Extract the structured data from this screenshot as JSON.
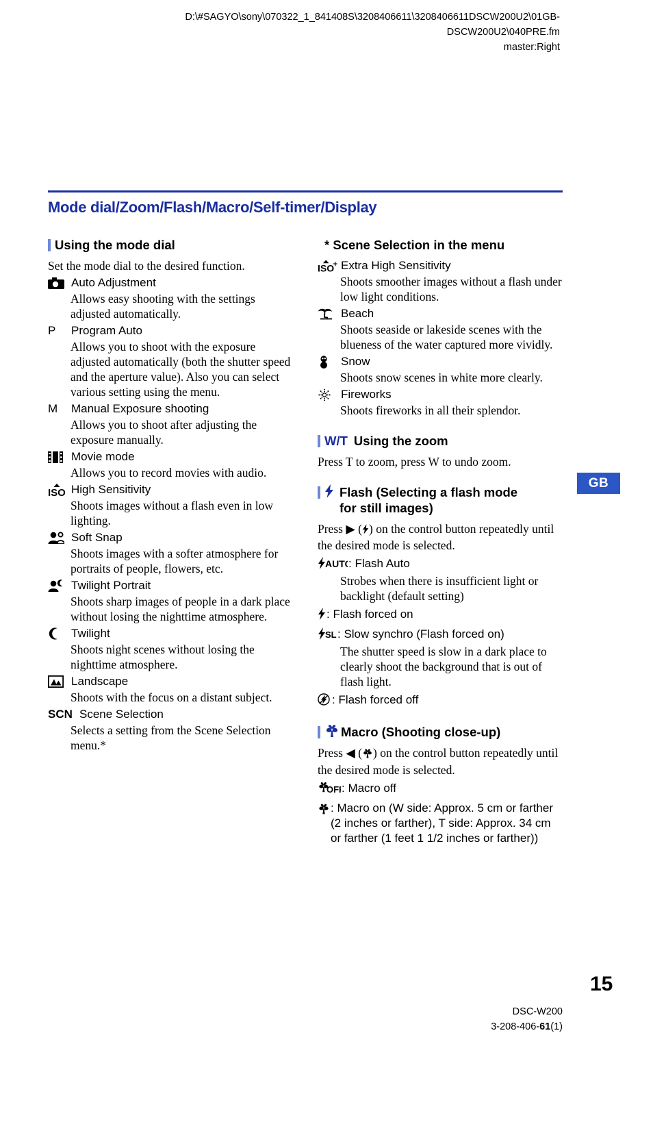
{
  "header": {
    "line1": "D:\\#SAGYO\\sony\\070322_1_841408S\\3208406611\\3208406611DSCW200U2\\01GB-",
    "line2": "DSCW200U2\\040PRE.fm",
    "line3": "master:Right"
  },
  "page_title": "Mode dial/Zoom/Flash/Macro/Self-timer/Display",
  "left_column": {
    "heading": "Using the mode dial",
    "intro": "Set the mode dial to the desired function.",
    "modes": [
      {
        "icon": "camera-icon",
        "label": "Auto Adjustment",
        "desc": "Allows easy shooting with the settings adjusted automatically."
      },
      {
        "icon": "letter-p",
        "label": "Program Auto",
        "desc": "Allows you to shoot with the exposure adjusted automatically (both the shutter speed and the aperture value). Also you can select various setting using the menu."
      },
      {
        "icon": "letter-m",
        "label": "Manual Exposure shooting",
        "desc": "Allows you to shoot after adjusting the exposure manually."
      },
      {
        "icon": "film-strip-icon",
        "label": "Movie mode",
        "desc": "Allows you to record movies with audio."
      },
      {
        "icon": "iso-high-icon",
        "label": "High Sensitivity",
        "desc": "Shoots images without a flash even in low lighting."
      },
      {
        "icon": "soft-snap-icon",
        "label": "Soft Snap",
        "desc": "Shoots images with a softer atmosphere for portraits of people, flowers, etc."
      },
      {
        "icon": "twilight-portrait-icon",
        "label": "Twilight Portrait",
        "desc": "Shoots sharp images of people in a dark place without losing the nighttime atmosphere."
      },
      {
        "icon": "moon-icon",
        "label": "Twilight",
        "desc": "Shoots night scenes without losing the nighttime atmosphere."
      },
      {
        "icon": "landscape-icon",
        "label": "Landscape",
        "desc": "Shoots with the focus on a distant subject."
      },
      {
        "icon": "scn-text",
        "label": "Scene Selection",
        "desc": "Selects a setting from the Scene Selection menu.*"
      }
    ]
  },
  "right_column": {
    "scene_heading": "* Scene Selection in the menu",
    "scenes": [
      {
        "icon": "iso-plus-icon",
        "label": "Extra High Sensitivity",
        "desc": "Shoots smoother images without a flash under low light conditions."
      },
      {
        "icon": "beach-icon",
        "label": "Beach",
        "desc": "Shoots seaside or lakeside scenes with the blueness of the water captured more vividly."
      },
      {
        "icon": "snowman-icon",
        "label": "Snow",
        "desc": "Shoots snow scenes in white more clearly."
      },
      {
        "icon": "fireworks-icon",
        "label": "Fireworks",
        "desc": "Shoots fireworks in all their splendor."
      }
    ],
    "zoom_section": {
      "heading_prefix": "W/T",
      "heading": "Using the zoom",
      "body": "Press T to zoom, press W to undo zoom."
    },
    "flash_section": {
      "heading_line1": "Flash (Selecting a flash mode",
      "heading_line2": "for still images)",
      "intro_a": "Press ",
      "intro_b": " (",
      "intro_c": ") on the control button repeatedly until the desired mode is selected.",
      "modes": [
        {
          "icon": "flash-auto-icon",
          "label": ": Flash Auto",
          "desc": "Strobes when there is insufficient light or backlight (default setting)"
        },
        {
          "icon": "flash-on-icon",
          "label": ": Flash forced on",
          "desc": ""
        },
        {
          "icon": "flash-slow-sync-icon",
          "label": ": Slow synchro (Flash forced on)",
          "desc": "The shutter speed is slow in a dark place to clearly shoot the background that is out of flash light."
        },
        {
          "icon": "flash-off-icon",
          "label": ": Flash forced off",
          "desc": ""
        }
      ]
    },
    "macro_section": {
      "heading": "Macro (Shooting close-up)",
      "intro_a": "Press ",
      "intro_b": " (",
      "intro_c": ") on the control button repeatedly until the desired mode is selected.",
      "items": [
        {
          "icon": "macro-off-icon",
          "label": ": Macro off"
        },
        {
          "icon": "macro-on-icon",
          "label": ": Macro on (W side: Approx. 5 cm or farther (2 inches or farther), T side: Approx. 34 cm or farther (1 feet 1 1/2 inches or farther))"
        }
      ]
    }
  },
  "gb_tab": "GB",
  "page_number": "15",
  "footer": {
    "model": "DSC-W200",
    "part_a": "3-208-406-",
    "part_b": "61",
    "part_c": "(1)"
  },
  "colors": {
    "title_blue": "#1a2ea0",
    "bar_blue": "#6f87d6",
    "tab_blue": "#2b56c4"
  }
}
